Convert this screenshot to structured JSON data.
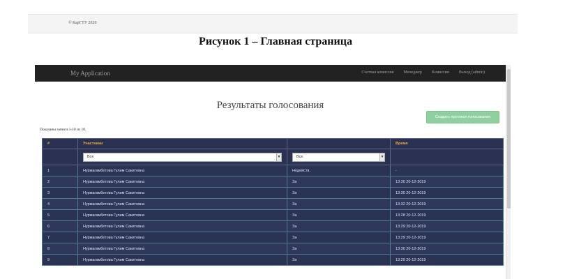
{
  "footer": {
    "copyright": "© КарГТУ 2020"
  },
  "caption": "Рисунок 1 – Главная страница",
  "navbar": {
    "brand": "My Application",
    "links": [
      "Счетная комиссия",
      "Менеджер",
      "Комиссия",
      "Выход (admin)"
    ]
  },
  "page": {
    "title": "Результаты голосования",
    "create_button": "Создать протокол голосования",
    "summary": "Показаны записи 1-10 из 10."
  },
  "table": {
    "headers": [
      "#",
      "Участники",
      "",
      "Время"
    ],
    "filters": {
      "participant": "Все",
      "vote": "Все"
    },
    "rows": [
      [
        "1",
        "Нурмагамбетова Гулим Сакитовна",
        "Недейств.",
        "-"
      ],
      [
        "2",
        "Нурмагамбетова Гулим Сакитовна",
        "За",
        "13:30 20-12-2019"
      ],
      [
        "3",
        "Нурмагамбетова Гулим Сакитовна",
        "За",
        "13:30 20-12-2019"
      ],
      [
        "4",
        "Нурмагамбетова Гулим Сакитовна",
        "За",
        "13:32 20-12-2019"
      ],
      [
        "5",
        "Нурмагамбетова Гулим Сакитовна",
        "За",
        "13:28 20-12-2019"
      ],
      [
        "6",
        "Нурмагамбетова Гулим Сакитовна",
        "За",
        "13:29 20-12-2019"
      ],
      [
        "7",
        "Нурмагамбетова Гулим Сакитовна",
        "За",
        "13:29 20-12-2019"
      ],
      [
        "8",
        "Нурмагамбетова Гулим Сакитовна",
        "За",
        "13:30 20-12-2019"
      ],
      [
        "9",
        "Нурмагамбетова Гулим Сакитовна",
        "За",
        "13:29 20-12-2019"
      ]
    ]
  },
  "icons": {
    "select_arrow": "chevron-down-icon"
  },
  "colors": {
    "navbar": "#222222",
    "table_bg": "#2a3151",
    "header_text": "#f0a93b",
    "button": "#8fd19e"
  }
}
